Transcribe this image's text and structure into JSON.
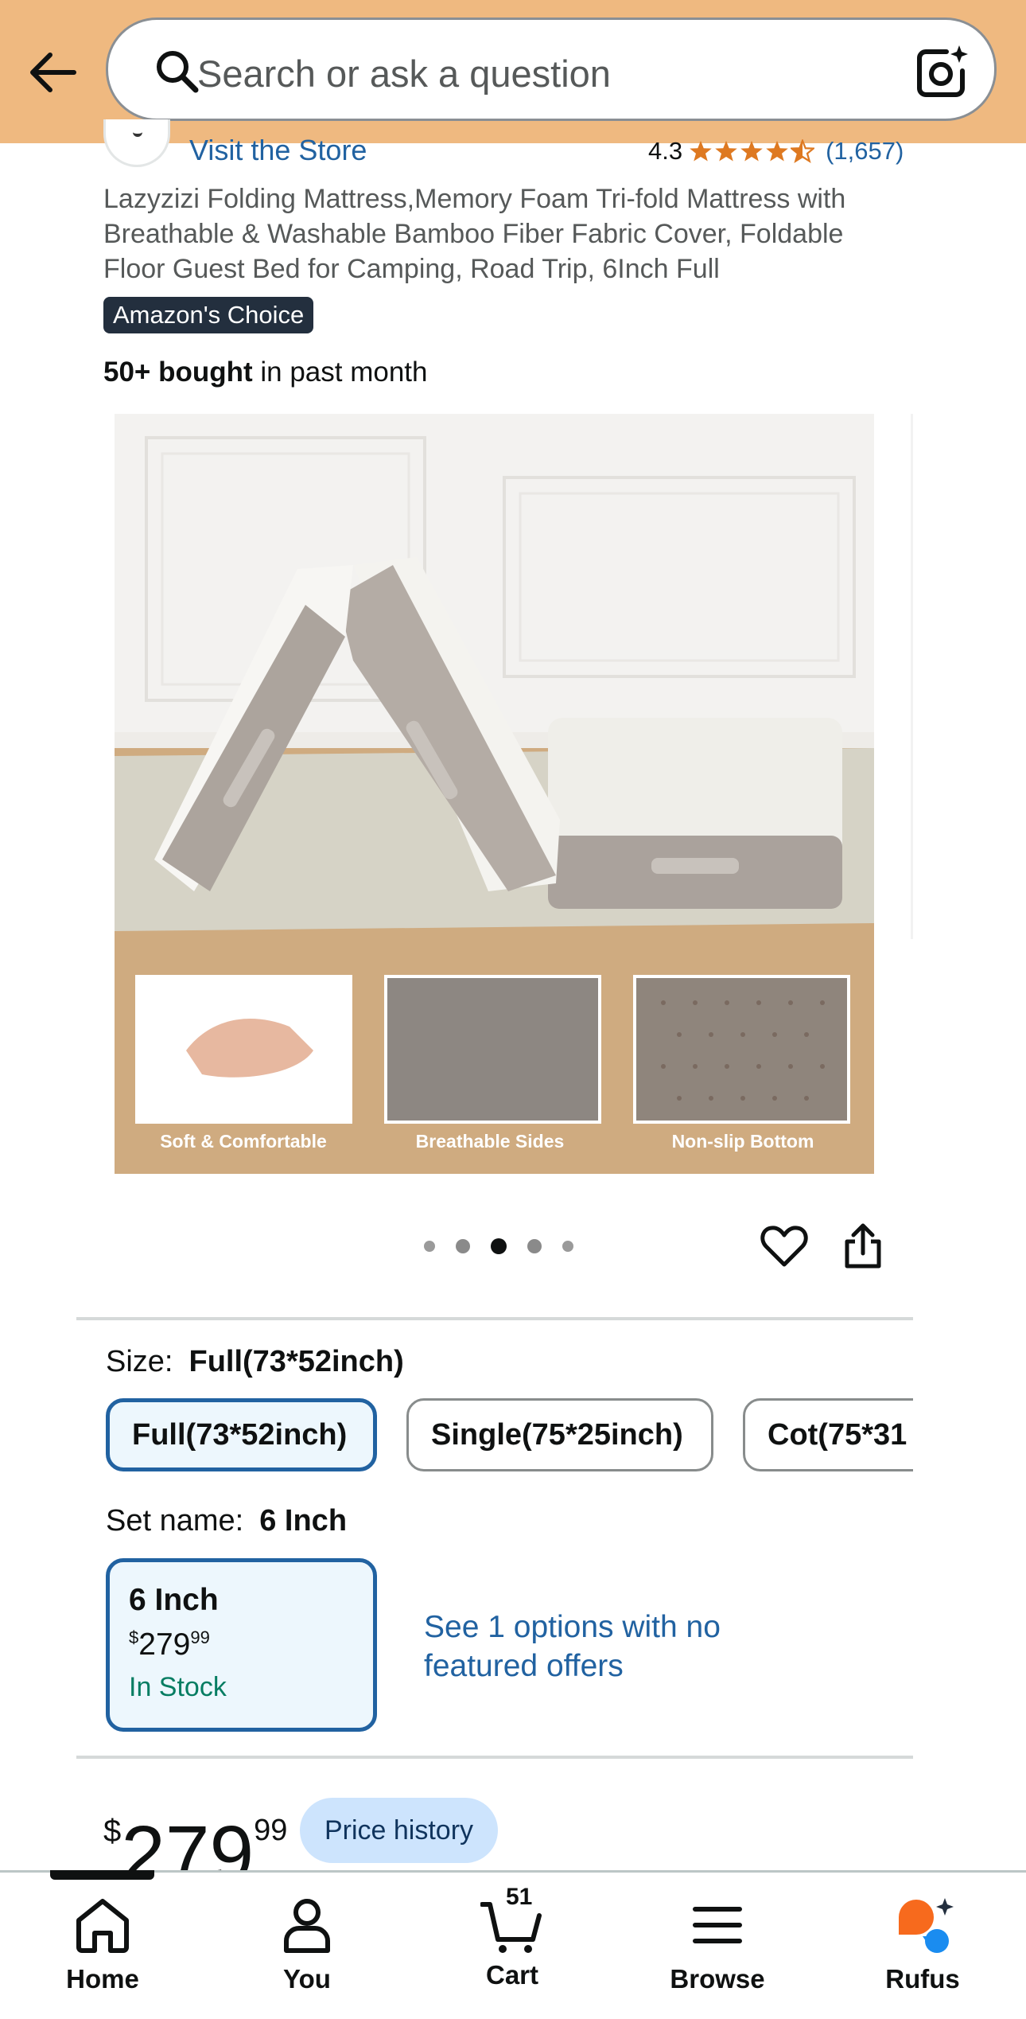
{
  "header": {
    "back_label": "Back",
    "search_placeholder": "Search or ask a question"
  },
  "store": {
    "link_text": "Visit the Store",
    "rating_value": "4.3",
    "rating_stars": 4.3,
    "review_count": "(1,657)"
  },
  "product": {
    "title": "Lazyzizi Folding Mattress,Memory Foam Tri-fold Mattress with Breathable & Washable Bamboo Fiber Fabric Cover, Foldable Floor Guest Bed for Camping, Road Trip, 6Inch Full",
    "badge": "Amazon's Choice",
    "bought_bold": "50+ bought",
    "bought_rest": " in past month"
  },
  "image": {
    "caption_1": "Soft & Comfortable",
    "caption_2": "Breathable Sides",
    "caption_3": "Non-slip Bottom",
    "dots_count": 5,
    "active_dot": 3
  },
  "size": {
    "label": "Size:",
    "selected": "Full(73*52inch)",
    "options": [
      "Full(73*52inch)",
      "Single(75*25inch)",
      "Cot(75*31"
    ]
  },
  "set": {
    "label": "Set name:",
    "selected": "6 Inch",
    "card_name": "6 Inch",
    "card_price_symbol": "$",
    "card_price_whole": "279",
    "card_price_cents": "99",
    "card_stock": "In Stock",
    "see_options": "See 1 options with no featured offers"
  },
  "price": {
    "symbol": "$",
    "whole": "279",
    "cents": "99",
    "history_label": "Price history"
  },
  "nav": {
    "home": "Home",
    "you": "You",
    "cart": "Cart",
    "cart_count": "51",
    "browse": "Browse",
    "rufus": "Rufus"
  },
  "colors": {
    "header_bg": "#efb980",
    "link": "#2162a1",
    "badge_bg": "#232f3e",
    "star": "#de7921",
    "in_stock": "#067d62",
    "selected_border": "#2162a1",
    "price_history_bg": "#cde4fd",
    "rufus_orange": "#f76a1d",
    "rufus_blue": "#1a8cf0"
  }
}
